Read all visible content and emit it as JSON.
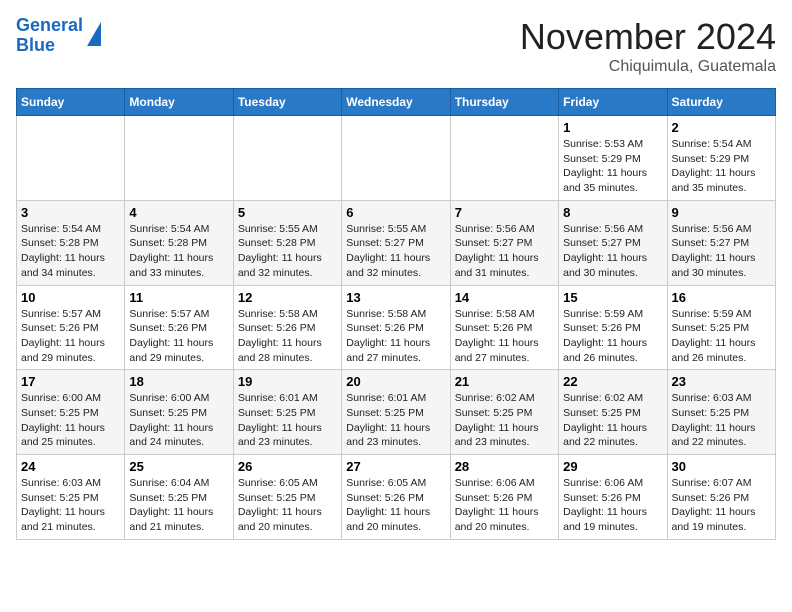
{
  "header": {
    "logo_line1": "General",
    "logo_line2": "Blue",
    "month_title": "November 2024",
    "location": "Chiquimula, Guatemala"
  },
  "weekdays": [
    "Sunday",
    "Monday",
    "Tuesday",
    "Wednesday",
    "Thursday",
    "Friday",
    "Saturday"
  ],
  "weeks": [
    [
      {
        "day": "",
        "sunrise": "",
        "sunset": "",
        "daylight": ""
      },
      {
        "day": "",
        "sunrise": "",
        "sunset": "",
        "daylight": ""
      },
      {
        "day": "",
        "sunrise": "",
        "sunset": "",
        "daylight": ""
      },
      {
        "day": "",
        "sunrise": "",
        "sunset": "",
        "daylight": ""
      },
      {
        "day": "",
        "sunrise": "",
        "sunset": "",
        "daylight": ""
      },
      {
        "day": "1",
        "sunrise": "Sunrise: 5:53 AM",
        "sunset": "Sunset: 5:29 PM",
        "daylight": "Daylight: 11 hours and 35 minutes."
      },
      {
        "day": "2",
        "sunrise": "Sunrise: 5:54 AM",
        "sunset": "Sunset: 5:29 PM",
        "daylight": "Daylight: 11 hours and 35 minutes."
      }
    ],
    [
      {
        "day": "3",
        "sunrise": "Sunrise: 5:54 AM",
        "sunset": "Sunset: 5:28 PM",
        "daylight": "Daylight: 11 hours and 34 minutes."
      },
      {
        "day": "4",
        "sunrise": "Sunrise: 5:54 AM",
        "sunset": "Sunset: 5:28 PM",
        "daylight": "Daylight: 11 hours and 33 minutes."
      },
      {
        "day": "5",
        "sunrise": "Sunrise: 5:55 AM",
        "sunset": "Sunset: 5:28 PM",
        "daylight": "Daylight: 11 hours and 32 minutes."
      },
      {
        "day": "6",
        "sunrise": "Sunrise: 5:55 AM",
        "sunset": "Sunset: 5:27 PM",
        "daylight": "Daylight: 11 hours and 32 minutes."
      },
      {
        "day": "7",
        "sunrise": "Sunrise: 5:56 AM",
        "sunset": "Sunset: 5:27 PM",
        "daylight": "Daylight: 11 hours and 31 minutes."
      },
      {
        "day": "8",
        "sunrise": "Sunrise: 5:56 AM",
        "sunset": "Sunset: 5:27 PM",
        "daylight": "Daylight: 11 hours and 30 minutes."
      },
      {
        "day": "9",
        "sunrise": "Sunrise: 5:56 AM",
        "sunset": "Sunset: 5:27 PM",
        "daylight": "Daylight: 11 hours and 30 minutes."
      }
    ],
    [
      {
        "day": "10",
        "sunrise": "Sunrise: 5:57 AM",
        "sunset": "Sunset: 5:26 PM",
        "daylight": "Daylight: 11 hours and 29 minutes."
      },
      {
        "day": "11",
        "sunrise": "Sunrise: 5:57 AM",
        "sunset": "Sunset: 5:26 PM",
        "daylight": "Daylight: 11 hours and 29 minutes."
      },
      {
        "day": "12",
        "sunrise": "Sunrise: 5:58 AM",
        "sunset": "Sunset: 5:26 PM",
        "daylight": "Daylight: 11 hours and 28 minutes."
      },
      {
        "day": "13",
        "sunrise": "Sunrise: 5:58 AM",
        "sunset": "Sunset: 5:26 PM",
        "daylight": "Daylight: 11 hours and 27 minutes."
      },
      {
        "day": "14",
        "sunrise": "Sunrise: 5:58 AM",
        "sunset": "Sunset: 5:26 PM",
        "daylight": "Daylight: 11 hours and 27 minutes."
      },
      {
        "day": "15",
        "sunrise": "Sunrise: 5:59 AM",
        "sunset": "Sunset: 5:26 PM",
        "daylight": "Daylight: 11 hours and 26 minutes."
      },
      {
        "day": "16",
        "sunrise": "Sunrise: 5:59 AM",
        "sunset": "Sunset: 5:25 PM",
        "daylight": "Daylight: 11 hours and 26 minutes."
      }
    ],
    [
      {
        "day": "17",
        "sunrise": "Sunrise: 6:00 AM",
        "sunset": "Sunset: 5:25 PM",
        "daylight": "Daylight: 11 hours and 25 minutes."
      },
      {
        "day": "18",
        "sunrise": "Sunrise: 6:00 AM",
        "sunset": "Sunset: 5:25 PM",
        "daylight": "Daylight: 11 hours and 24 minutes."
      },
      {
        "day": "19",
        "sunrise": "Sunrise: 6:01 AM",
        "sunset": "Sunset: 5:25 PM",
        "daylight": "Daylight: 11 hours and 23 minutes."
      },
      {
        "day": "20",
        "sunrise": "Sunrise: 6:01 AM",
        "sunset": "Sunset: 5:25 PM",
        "daylight": "Daylight: 11 hours and 23 minutes."
      },
      {
        "day": "21",
        "sunrise": "Sunrise: 6:02 AM",
        "sunset": "Sunset: 5:25 PM",
        "daylight": "Daylight: 11 hours and 23 minutes."
      },
      {
        "day": "22",
        "sunrise": "Sunrise: 6:02 AM",
        "sunset": "Sunset: 5:25 PM",
        "daylight": "Daylight: 11 hours and 22 minutes."
      },
      {
        "day": "23",
        "sunrise": "Sunrise: 6:03 AM",
        "sunset": "Sunset: 5:25 PM",
        "daylight": "Daylight: 11 hours and 22 minutes."
      }
    ],
    [
      {
        "day": "24",
        "sunrise": "Sunrise: 6:03 AM",
        "sunset": "Sunset: 5:25 PM",
        "daylight": "Daylight: 11 hours and 21 minutes."
      },
      {
        "day": "25",
        "sunrise": "Sunrise: 6:04 AM",
        "sunset": "Sunset: 5:25 PM",
        "daylight": "Daylight: 11 hours and 21 minutes."
      },
      {
        "day": "26",
        "sunrise": "Sunrise: 6:05 AM",
        "sunset": "Sunset: 5:25 PM",
        "daylight": "Daylight: 11 hours and 20 minutes."
      },
      {
        "day": "27",
        "sunrise": "Sunrise: 6:05 AM",
        "sunset": "Sunset: 5:26 PM",
        "daylight": "Daylight: 11 hours and 20 minutes."
      },
      {
        "day": "28",
        "sunrise": "Sunrise: 6:06 AM",
        "sunset": "Sunset: 5:26 PM",
        "daylight": "Daylight: 11 hours and 20 minutes."
      },
      {
        "day": "29",
        "sunrise": "Sunrise: 6:06 AM",
        "sunset": "Sunset: 5:26 PM",
        "daylight": "Daylight: 11 hours and 19 minutes."
      },
      {
        "day": "30",
        "sunrise": "Sunrise: 6:07 AM",
        "sunset": "Sunset: 5:26 PM",
        "daylight": "Daylight: 11 hours and 19 minutes."
      }
    ]
  ]
}
